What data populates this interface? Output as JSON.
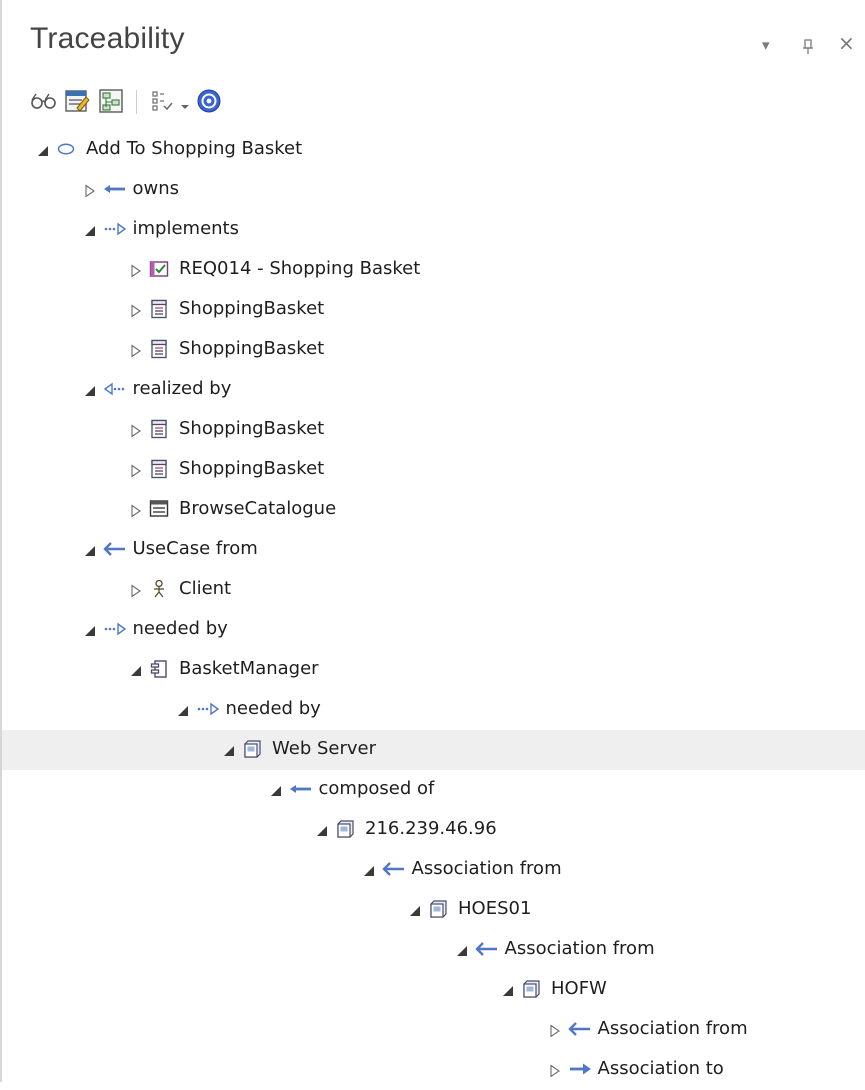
{
  "window": {
    "title": "Traceability",
    "controls": {
      "menu_glyph": "▾",
      "pin_glyph": "⊥",
      "close_glyph": "×"
    }
  },
  "toolbar": {
    "buttons": [
      {
        "icon": "glasses-icon"
      },
      {
        "icon": "properties-icon"
      },
      {
        "icon": "hierarchy-icon"
      },
      {
        "icon": "filter-checklist-icon"
      },
      {
        "icon": "dropdown-arrow-icon"
      },
      {
        "icon": "help-icon"
      }
    ]
  },
  "tree": [
    {
      "label": "Add To Shopping Basket",
      "level": 0,
      "expanded": true,
      "icon": "use-case-icon"
    },
    {
      "label": "owns",
      "level": 1,
      "expanded": false,
      "icon": "arrow-left-icon"
    },
    {
      "label": "implements",
      "level": 1,
      "expanded": true,
      "icon": "dotted-arrow-right-icon"
    },
    {
      "label": "REQ014 - Shopping Basket",
      "level": 2,
      "expanded": false,
      "icon": "requirement-icon"
    },
    {
      "label": "ShoppingBasket",
      "level": 2,
      "expanded": false,
      "icon": "class-icon"
    },
    {
      "label": "ShoppingBasket",
      "level": 2,
      "expanded": false,
      "icon": "class-icon"
    },
    {
      "label": "realized by",
      "level": 1,
      "expanded": true,
      "icon": "dotted-arrow-left-icon"
    },
    {
      "label": "ShoppingBasket",
      "level": 2,
      "expanded": false,
      "icon": "class-icon"
    },
    {
      "label": "ShoppingBasket",
      "level": 2,
      "expanded": false,
      "icon": "class-icon"
    },
    {
      "label": "BrowseCatalogue",
      "level": 2,
      "expanded": false,
      "icon": "screen-icon"
    },
    {
      "label": "UseCase from",
      "level": 1,
      "expanded": true,
      "icon": "thin-arrow-left-icon"
    },
    {
      "label": "Client",
      "level": 2,
      "expanded": false,
      "icon": "actor-icon"
    },
    {
      "label": "needed by",
      "level": 1,
      "expanded": true,
      "icon": "dotted-arrow-right-icon"
    },
    {
      "label": "BasketManager",
      "level": 2,
      "expanded": true,
      "icon": "component-icon"
    },
    {
      "label": "needed by",
      "level": 3,
      "expanded": true,
      "icon": "dotted-arrow-right-icon"
    },
    {
      "label": "Web Server",
      "level": 4,
      "expanded": true,
      "icon": "node-icon",
      "selected": true
    },
    {
      "label": "composed of",
      "level": 5,
      "expanded": true,
      "icon": "arrow-left-icon"
    },
    {
      "label": "216.239.46.96",
      "level": 6,
      "expanded": true,
      "icon": "node-icon"
    },
    {
      "label": "Association from",
      "level": 7,
      "expanded": true,
      "icon": "thin-arrow-left-icon"
    },
    {
      "label": "HOES01",
      "level": 8,
      "expanded": true,
      "icon": "node-icon"
    },
    {
      "label": "Association from",
      "level": 9,
      "expanded": true,
      "icon": "thin-arrow-left-icon"
    },
    {
      "label": "HOFW",
      "level": 10,
      "expanded": true,
      "icon": "node-icon"
    },
    {
      "label": "Association from",
      "level": 11,
      "expanded": false,
      "icon": "thin-arrow-left-icon"
    },
    {
      "label": "Association to",
      "level": 11,
      "expanded": false,
      "icon": "arrow-right-icon"
    }
  ],
  "colors": {
    "relation_blue": "#4f77c4",
    "selected_row": "#efefef",
    "title_text": "#444444"
  }
}
